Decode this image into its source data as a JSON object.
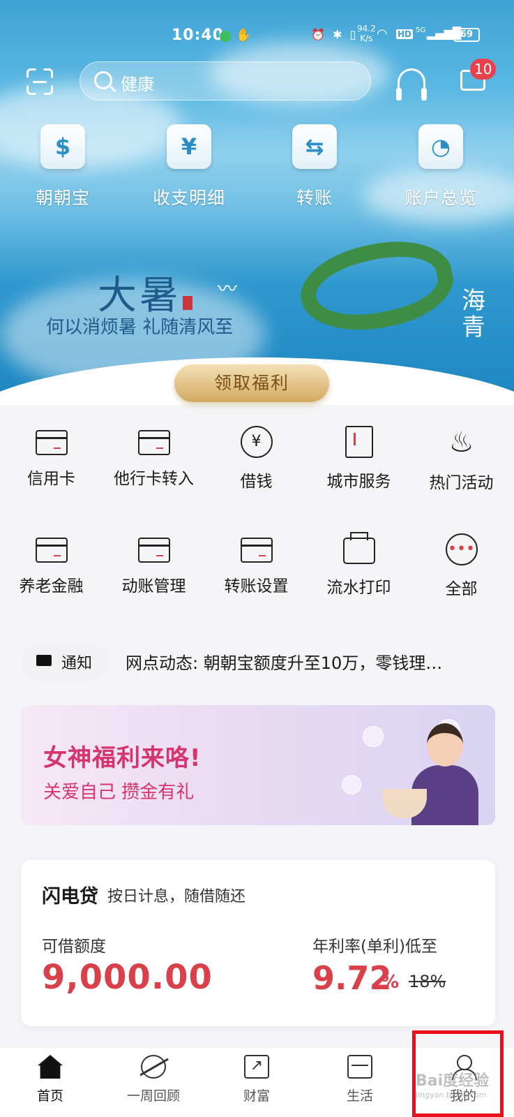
{
  "status_bar": {
    "time": "10:40",
    "network_speed": "94.2\nK/s",
    "hd": "HD",
    "signal": "5G",
    "battery": "69"
  },
  "header": {
    "search_placeholder": "健康",
    "message_badge": "10"
  },
  "quick_actions": [
    {
      "label": "朝朝宝",
      "icon": "moneybag-icon",
      "glyph": "$"
    },
    {
      "label": "收支明细",
      "icon": "yen-icon",
      "glyph": "¥"
    },
    {
      "label": "转账",
      "icon": "transfer-icon",
      "glyph": "⇆"
    },
    {
      "label": "账户总览",
      "icon": "ring-chart-icon",
      "glyph": "◔"
    }
  ],
  "banner": {
    "title": "大暑",
    "subtitle": "何以消烦暑 礼随清风至",
    "side_text": "海\n青",
    "cta": "领取福利"
  },
  "services_row1": [
    {
      "label": "信用卡",
      "icon": "credit-card-icon"
    },
    {
      "label": "他行卡转入",
      "icon": "card-transfer-in-icon"
    },
    {
      "label": "借钱",
      "icon": "borrow-yen-icon"
    },
    {
      "label": "城市服务",
      "icon": "city-building-icon"
    },
    {
      "label": "热门活动",
      "icon": "flame-icon"
    }
  ],
  "services_row2": [
    {
      "label": "养老金融",
      "icon": "pension-card-icon"
    },
    {
      "label": "动账管理",
      "icon": "account-change-icon"
    },
    {
      "label": "转账设置",
      "icon": "transfer-settings-icon"
    },
    {
      "label": "流水打印",
      "icon": "printer-icon"
    },
    {
      "label": "全部",
      "icon": "more-dots-icon"
    }
  ],
  "notice": {
    "tag": "通知",
    "text": "网点动态: 朝朝宝额度升至10万，零钱理…"
  },
  "promo": {
    "title": "女神福利来咯!",
    "subtitle": "关爱自己 攒金有礼"
  },
  "loan": {
    "title": "闪电贷",
    "subtitle": "按日计息，随借随还",
    "limit_label": "可借额度",
    "limit_value": "9,000.00",
    "rate_label": "年利率(单利)低至",
    "rate_value": "9.72",
    "rate_unit": "%",
    "old_rate": "18%"
  },
  "tabs": [
    {
      "label": "首页",
      "icon": "home-icon",
      "active": true
    },
    {
      "label": "一周回顾",
      "icon": "planet-icon",
      "active": false
    },
    {
      "label": "财富",
      "icon": "wealth-chart-icon",
      "active": false
    },
    {
      "label": "生活",
      "icon": "ticket-icon",
      "active": false
    },
    {
      "label": "我的",
      "icon": "user-icon",
      "active": false
    }
  ],
  "watermark": {
    "brand": "Bai度经验",
    "url": "jingyan.baidu.com"
  },
  "colors": {
    "accent_red": "#d9404a",
    "promo_pink": "#d6346d",
    "highlight_box": "#e8101a"
  }
}
